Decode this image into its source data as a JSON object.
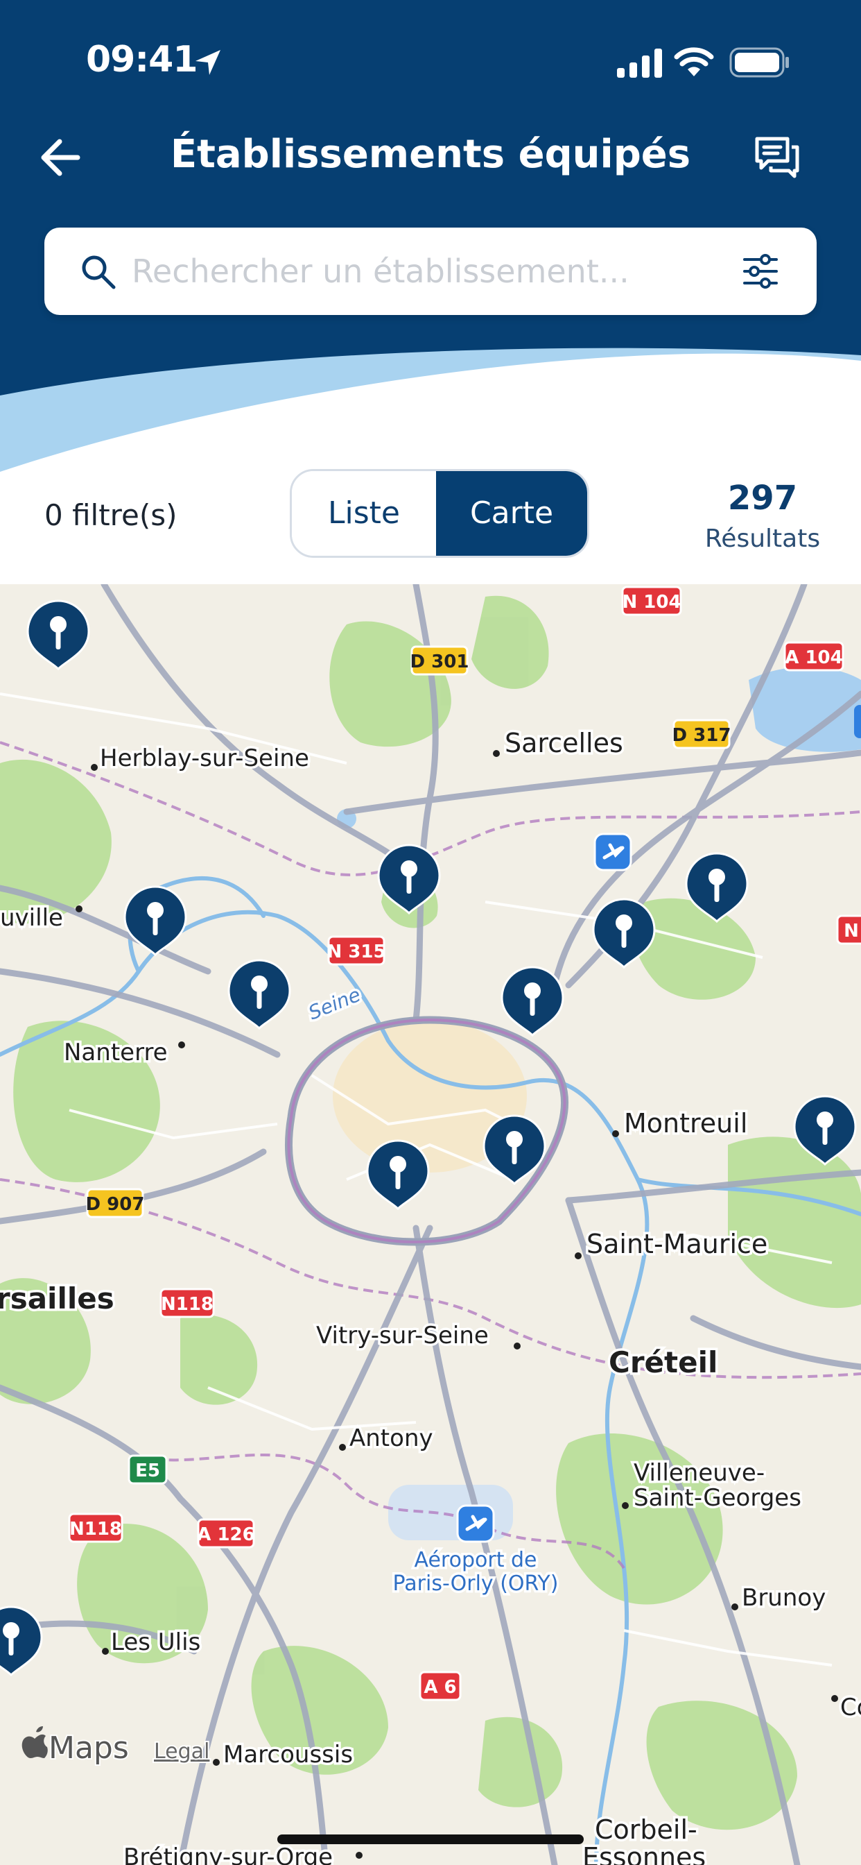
{
  "status_bar": {
    "time": "09:41"
  },
  "header": {
    "title": "Établissements équipés"
  },
  "search": {
    "placeholder": "Rechercher un établissement..."
  },
  "filters": {
    "label": "0 filtre(s)"
  },
  "view_toggle": {
    "list": "Liste",
    "map": "Carte",
    "selected": "Carte"
  },
  "results": {
    "count": "297",
    "label": "Résultats"
  },
  "map": {
    "places": {
      "herblay": "Herblay-sur-Seine",
      "sarcelles": "Sarcelles",
      "uville": "uville",
      "nanterre": "Nanterre",
      "montreuil": "Montreuil",
      "saint_maurice": "Saint-Maurice",
      "versailles": "rsailles",
      "vitry": "Vitry-sur-Seine",
      "creteil": "Créteil",
      "antony": "Antony",
      "villeneuve_1": "Villeneuve-",
      "villeneuve_2": "Saint-Georges",
      "brunoy": "Brunoy",
      "les_ulis": "Les Ulis",
      "marcoussis": "Marcoussis",
      "corbeil_1": "Corbeil-",
      "corbeil_2": "Essonnes",
      "bretigny": "Brétigny-sur-Orge",
      "co": "Co",
      "seine": "Seine",
      "orly_1": "Aéroport de",
      "orly_2": "Paris-Orly (ORY)"
    },
    "road_signs": {
      "n104": "N 104",
      "a104": "A 104",
      "d301": "D 301",
      "d317": "D 317",
      "n315": "N 315",
      "d907": "D 907",
      "n118a": "N118",
      "n118b": "N118",
      "a126": "A 126",
      "e5": "E5",
      "a6": "A 6",
      "n_edge": "N"
    },
    "attribution": {
      "brand": "Maps",
      "legal": "Legal"
    },
    "pin_icon": "map-pin-icon"
  },
  "colors": {
    "primary": "#063f72",
    "accent_wave": "#a9d3f0",
    "map_base": "#f2efe6",
    "park": "#b9de9a"
  }
}
